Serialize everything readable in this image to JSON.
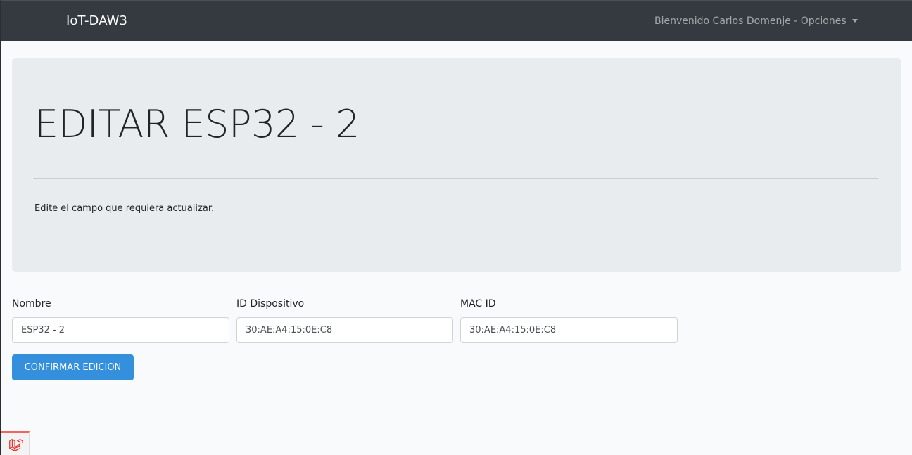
{
  "navbar": {
    "brand": "IoT-DAW3",
    "user_menu_label": "Bienvenido Carlos Domenje - Opciones"
  },
  "header": {
    "title": "EDITAR ESP32 - 2",
    "lead": "Edite el campo que requiera actualizar."
  },
  "form": {
    "fields": [
      {
        "label": "Nombre",
        "value": "ESP32 - 2"
      },
      {
        "label": "ID Dispositivo",
        "value": "30:AE:A4:15:0E:C8"
      },
      {
        "label": "MAC ID",
        "value": "30:AE:A4:15:0E:C8"
      }
    ],
    "submit_label": "CONFIRMAR EDICION"
  },
  "colors": {
    "navbar_bg": "#343a40",
    "primary": "#3490dc",
    "jumbotron_bg": "#e9ecef",
    "debugbar_accent": "#f4645f"
  },
  "icons": {
    "debugbar": "laravel-logo-icon",
    "user_menu": "chevron-down-icon"
  }
}
